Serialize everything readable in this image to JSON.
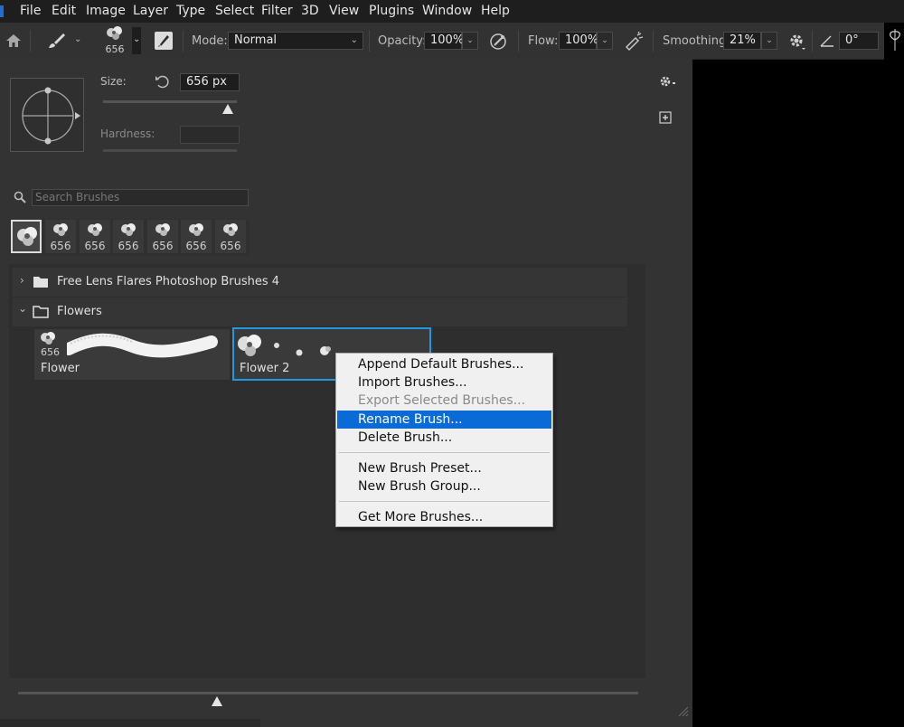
{
  "menubar": {
    "items": [
      "File",
      "Edit",
      "Image",
      "Layer",
      "Type",
      "Select",
      "Filter",
      "3D",
      "View",
      "Plugins",
      "Window",
      "Help"
    ]
  },
  "options_bar": {
    "brush_size": "656",
    "mode_label": "Mode:",
    "mode_value": "Normal",
    "opacity_label": "Opacity:",
    "opacity_value": "100%",
    "flow_label": "Flow:",
    "flow_value": "100%",
    "smoothing_label": "Smoothing:",
    "smoothing_value": "21%",
    "angle_value": "0°"
  },
  "brush_panel": {
    "size_label": "Size:",
    "size_value": "656 px",
    "size_slider_fraction": 0.93,
    "hardness_label": "Hardness:",
    "hardness_value": "",
    "search_placeholder": "Search Brushes",
    "recent_brushes": [
      {
        "label": ""
      },
      {
        "label": "656"
      },
      {
        "label": "656"
      },
      {
        "label": "656"
      },
      {
        "label": "656"
      },
      {
        "label": "656"
      },
      {
        "label": "656"
      }
    ],
    "groups": [
      {
        "name": "Free Lens Flares Photoshop Brushes 4",
        "expanded": false
      },
      {
        "name": "Flowers",
        "expanded": true
      }
    ],
    "brushes": [
      {
        "size": "656",
        "name": "Flower"
      },
      {
        "size": "",
        "name": "Flower 2",
        "selected": true
      }
    ],
    "bottom_slider_fraction": 0.32
  },
  "context_menu": {
    "items": [
      {
        "label": "Append Default Brushes...",
        "state": "enabled"
      },
      {
        "label": "Import Brushes...",
        "state": "enabled"
      },
      {
        "label": "Export Selected Brushes...",
        "state": "disabled"
      },
      {
        "label": "Rename Brush...",
        "state": "highlighted"
      },
      {
        "label": "Delete Brush...",
        "state": "enabled"
      },
      {
        "label": "New Brush Preset...",
        "state": "enabled"
      },
      {
        "label": "New Brush Group...",
        "state": "enabled"
      },
      {
        "label": "Get More Brushes...",
        "state": "enabled"
      }
    ]
  },
  "colors": {
    "menubar_bg": "#1e1e1e",
    "panel_bg": "#333333",
    "selection_border": "#1e9be0",
    "menu_highlight": "#0a6ad6"
  },
  "icons": [
    "home-icon",
    "brush-tool-icon",
    "brush-preset-icon",
    "brush-settings-icon",
    "airbrush-icon",
    "pressure-opacity-icon",
    "gear-icon",
    "angle-icon",
    "symmetry-icon",
    "reset-icon",
    "search-icon",
    "folder-icon",
    "chevron-right-icon",
    "chevron-down-icon",
    "new-group-icon",
    "resize-grip-icon"
  ]
}
